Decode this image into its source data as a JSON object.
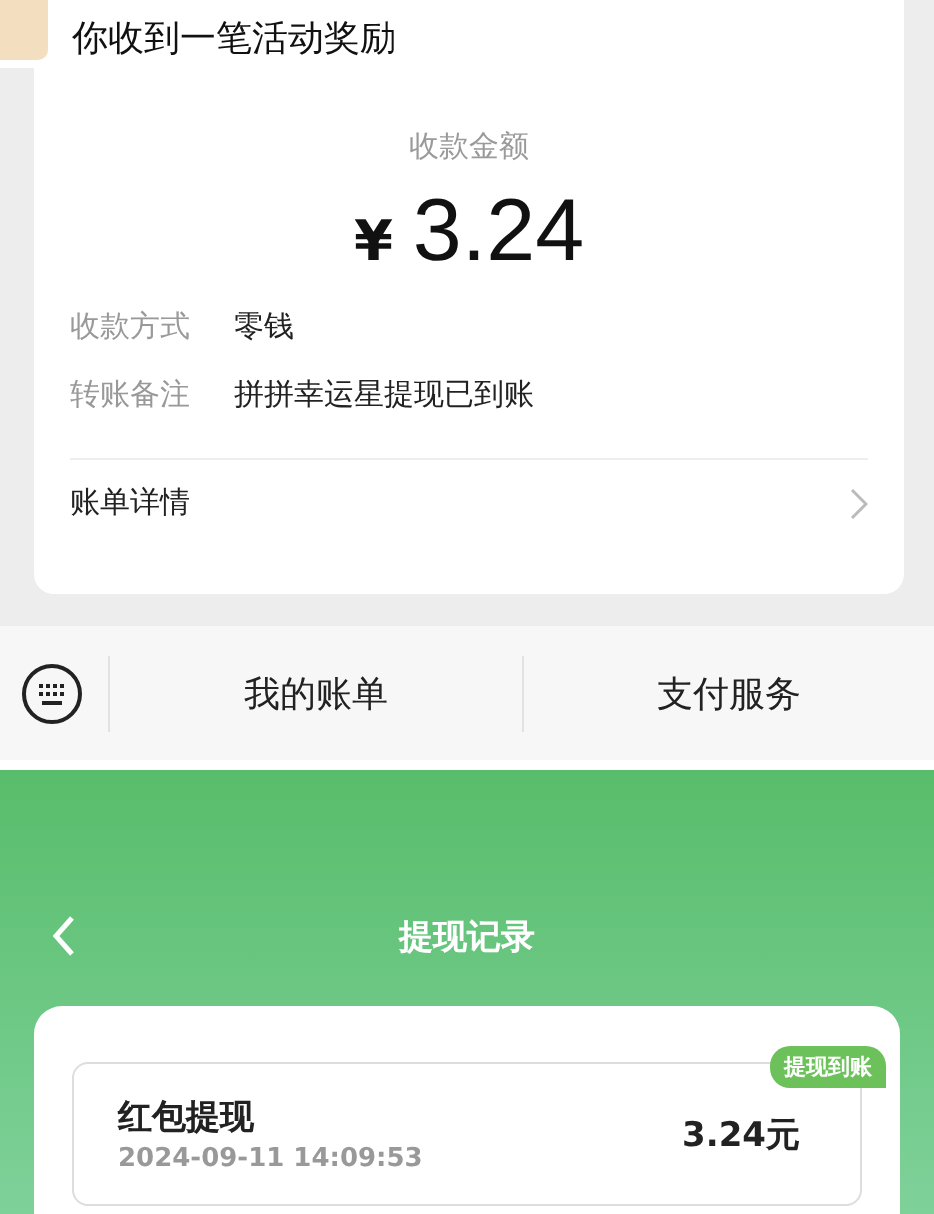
{
  "message": {
    "title": "你收到一笔活动奖励",
    "amount_label": "收款金额",
    "currency": "¥",
    "amount": "3.24",
    "fields": [
      {
        "label": "收款方式",
        "value": "零钱"
      },
      {
        "label": "转账备注",
        "value": "拼拼幸运星提现已到账"
      }
    ],
    "details_link": "账单详情"
  },
  "bottom_bar": {
    "items": [
      "我的账单",
      "支付服务"
    ]
  },
  "withdraw_page": {
    "title": "提现记录",
    "records": [
      {
        "title": "红包提现",
        "time": "2024-09-11 14:09:53",
        "amount": "3.24元",
        "status": "提现到账"
      }
    ]
  }
}
